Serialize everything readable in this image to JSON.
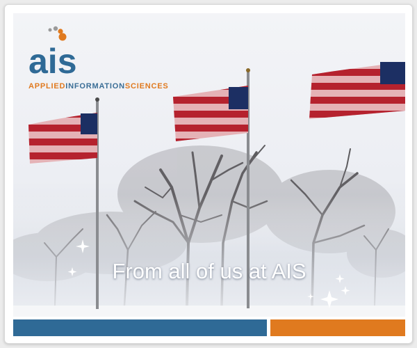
{
  "brand": {
    "logo_word": "ais",
    "name_part1": "APPLIED",
    "name_part2": "INFORMATION",
    "name_part3": "SCIENCES"
  },
  "banner": {
    "greeting": "From all of us at AIS"
  },
  "colors": {
    "brand_blue": "#2f6a96",
    "brand_orange": "#e07a1f",
    "dot_grey": "#9a9a9a",
    "dot_orange": "#e07a1f"
  },
  "icons": {
    "logo_dots": "logo-dots-icon",
    "sparkle": "sparkle-icon"
  }
}
